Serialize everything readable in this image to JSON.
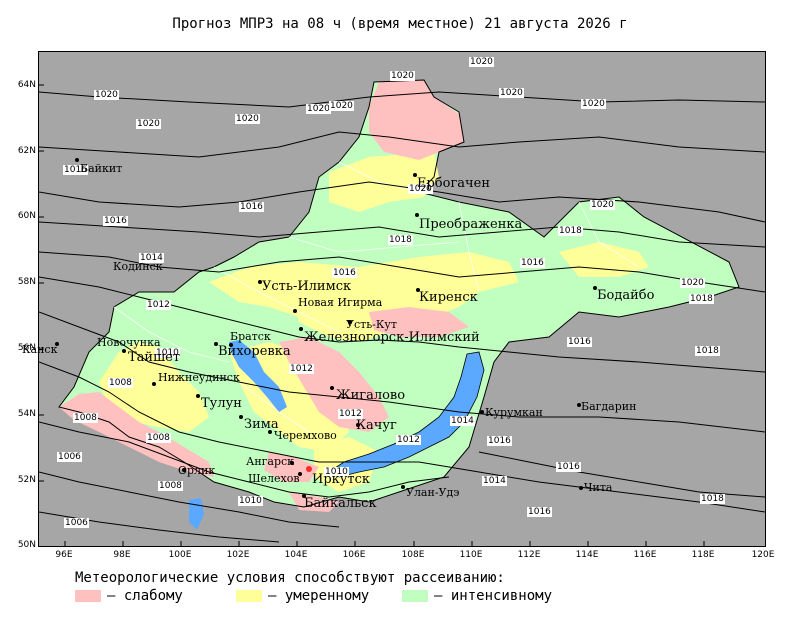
{
  "title": "Прогноз МПРЗ на 08 ч (время местное) 21 августа 2026 г",
  "colors": {
    "sea": "#a6a6a6",
    "weak": "#ffc0c0",
    "moderate": "#ffff99",
    "intensive": "#c0ffc0",
    "water": "#5aa8ff"
  },
  "lat_labels": [
    "64N",
    "62N",
    "60N",
    "58N",
    "56N",
    "54N",
    "52N",
    "50N"
  ],
  "lon_labels": [
    "96E",
    "98E",
    "100E",
    "102E",
    "104E",
    "106E",
    "108E",
    "110E",
    "112E",
    "114E",
    "116E",
    "118E",
    "120E"
  ],
  "isobar_labels": [
    "1020",
    "1020",
    "1020",
    "1020",
    "1020",
    "1020",
    "1020",
    "1020",
    "1020",
    "1020",
    "1020",
    "1020",
    "1016",
    "1016",
    "1016",
    "1016",
    "1018",
    "1018",
    "1018",
    "1018",
    "1016",
    "1014",
    "1014",
    "1012",
    "1012",
    "1012",
    "1012",
    "1010",
    "1010",
    "1010",
    "1008",
    "1008",
    "1008",
    "1008",
    "1006",
    "1006",
    "1016",
    "1016",
    "1016",
    "1016",
    "1014",
    "1018"
  ],
  "cities": [
    {
      "name": "Ербогачен",
      "big": true
    },
    {
      "name": "Преображенка",
      "big": true
    },
    {
      "name": "Байкит",
      "big": false
    },
    {
      "name": "Кодинск",
      "big": false
    },
    {
      "name": "Усть-Илимск",
      "big": true
    },
    {
      "name": "Киренск",
      "big": true
    },
    {
      "name": "Бодайбо",
      "big": true
    },
    {
      "name": "Новая Игирма",
      "big": false
    },
    {
      "name": "Усть-Кут",
      "big": false
    },
    {
      "name": "Братск",
      "big": false
    },
    {
      "name": "Вихоревка",
      "big": true
    },
    {
      "name": "Железногорск-Илимский",
      "big": true
    },
    {
      "name": "Канск",
      "big": false
    },
    {
      "name": "Новочунка",
      "big": false
    },
    {
      "name": "Тайшет",
      "big": true
    },
    {
      "name": "Нижнеудинск",
      "big": false
    },
    {
      "name": "Жигалово",
      "big": true
    },
    {
      "name": "Тулун",
      "big": true
    },
    {
      "name": "Зима",
      "big": true
    },
    {
      "name": "Черемхово",
      "big": false
    },
    {
      "name": "Качуг",
      "big": true
    },
    {
      "name": "Курумкан",
      "big": false
    },
    {
      "name": "Багдарин",
      "big": false
    },
    {
      "name": "Ангарск",
      "big": false
    },
    {
      "name": "Орлик",
      "big": false
    },
    {
      "name": "Шелехов",
      "big": false
    },
    {
      "name": "Иркутск",
      "big": true
    },
    {
      "name": "Улан-Удэ",
      "big": false
    },
    {
      "name": "Чита",
      "big": false
    },
    {
      "name": "Байкальск",
      "big": true
    }
  ],
  "legend": {
    "title": "Метеорологические условия способствуют рассеиванию:",
    "items": [
      {
        "label": "– слабому",
        "color": "#ffc0c0"
      },
      {
        "label": "– умеренному",
        "color": "#ffff99"
      },
      {
        "label": "– интенсивному",
        "color": "#c0ffc0"
      }
    ]
  }
}
